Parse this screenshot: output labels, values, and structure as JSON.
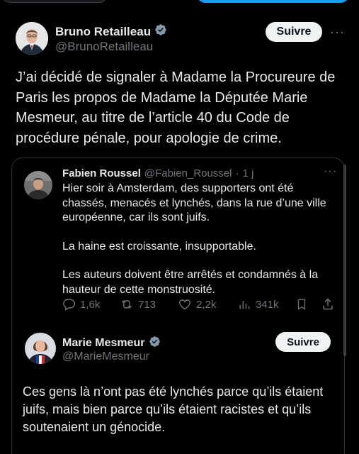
{
  "main_post": {
    "author_name": "Bruno Retailleau",
    "author_handle": "@BrunoRetailleau",
    "follow_label": "Suivre",
    "more_label": "···",
    "text": "J’ai décidé de signaler à Madame la Procureure de Paris les propos de Madame la Députée Marie Mesmeur, au titre de l’article 40 du Code de procédure pénale, pour apologie de crime."
  },
  "quoted_post": {
    "author_name": "Fabien Roussel",
    "author_handle": "@Fabien_Roussel",
    "separator": "·",
    "time": "1 j",
    "more_label": "···",
    "paragraphs": [
      "Hier soir à Amsterdam, des supporters ont été chassés, menacés et lynchés, dans la rue d’une ville européenne, car ils sont juifs.",
      "La haine est croissante, insupportable.",
      "Les auteurs doivent être arrêtés et condamnés à la hauteur de cette monstruosité."
    ],
    "stats": {
      "replies": "1,6k",
      "reposts": "713",
      "likes": "2,2k",
      "views": "341k"
    }
  },
  "reply_post": {
    "author_name": "Marie Mesmeur",
    "author_handle": "@MarieMesmeur",
    "follow_label": "Suivre",
    "text": "Ces gens là n’ont pas été lynchés parce qu’ils étaient juifs, mais bien parce qu’ils étaient racistes et qu’ils soutenaient un génocide."
  },
  "colors": {
    "background": "#000000",
    "text": "#e7e9ea",
    "muted": "#71767b",
    "verified_blue": "#1d9bf0",
    "verified_gray": "#829aab",
    "border": "#2f3336"
  },
  "icons": [
    "verified-icon",
    "reply-icon",
    "repost-icon",
    "like-icon",
    "views-icon",
    "bookmark-icon",
    "share-icon"
  ]
}
